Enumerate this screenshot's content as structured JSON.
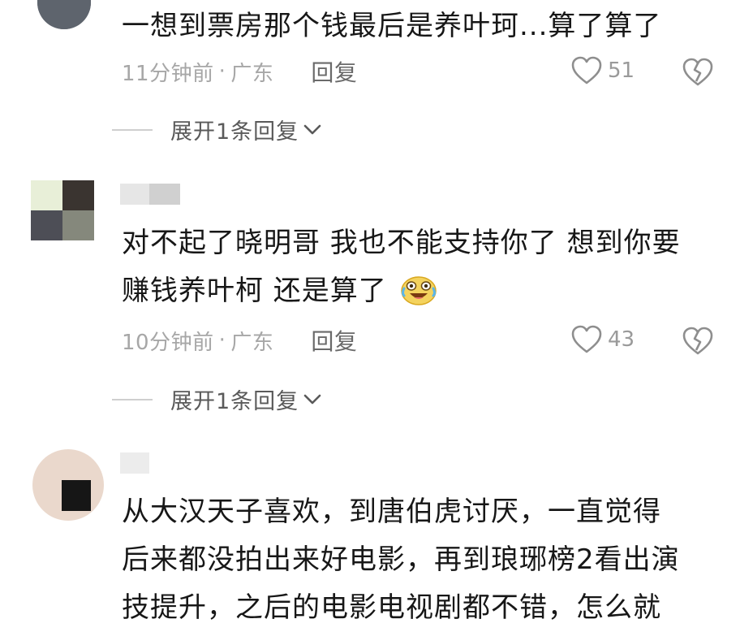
{
  "comments": [
    {
      "text_lines": [
        "一想到票房那个钱最后是养叶珂...算了算了"
      ],
      "time": "11分钟前",
      "location": "广东",
      "reply_label": "回复",
      "likes": "51",
      "expand_label": "展开1条回复"
    },
    {
      "text_lines": [
        "对不起了晓明哥 我也不能支持你了 想到你要",
        "赚钱养叶柯 还是算了"
      ],
      "time": "10分钟前",
      "location": "广东",
      "reply_label": "回复",
      "likes": "43",
      "expand_label": "展开1条回复"
    },
    {
      "text_lines": [
        "从大汉天子喜欢，到唐伯虎讨厌，一直觉得",
        "后来都没拍出来好电影，再到琅琊榜2看出演",
        "技提升，之后的电影电视剧都不错，怎么就"
      ]
    }
  ],
  "separator": "·",
  "icons": {
    "like": "heart-outline-icon",
    "dislike": "broken-heart-icon",
    "expand": "chevron-down-icon",
    "emoji": "laughing-tears-emoji"
  },
  "colors": {
    "text": "#171717",
    "meta": "#a7a7a7",
    "reply": "#6a6a6a",
    "icon": "#8e8e8e"
  }
}
